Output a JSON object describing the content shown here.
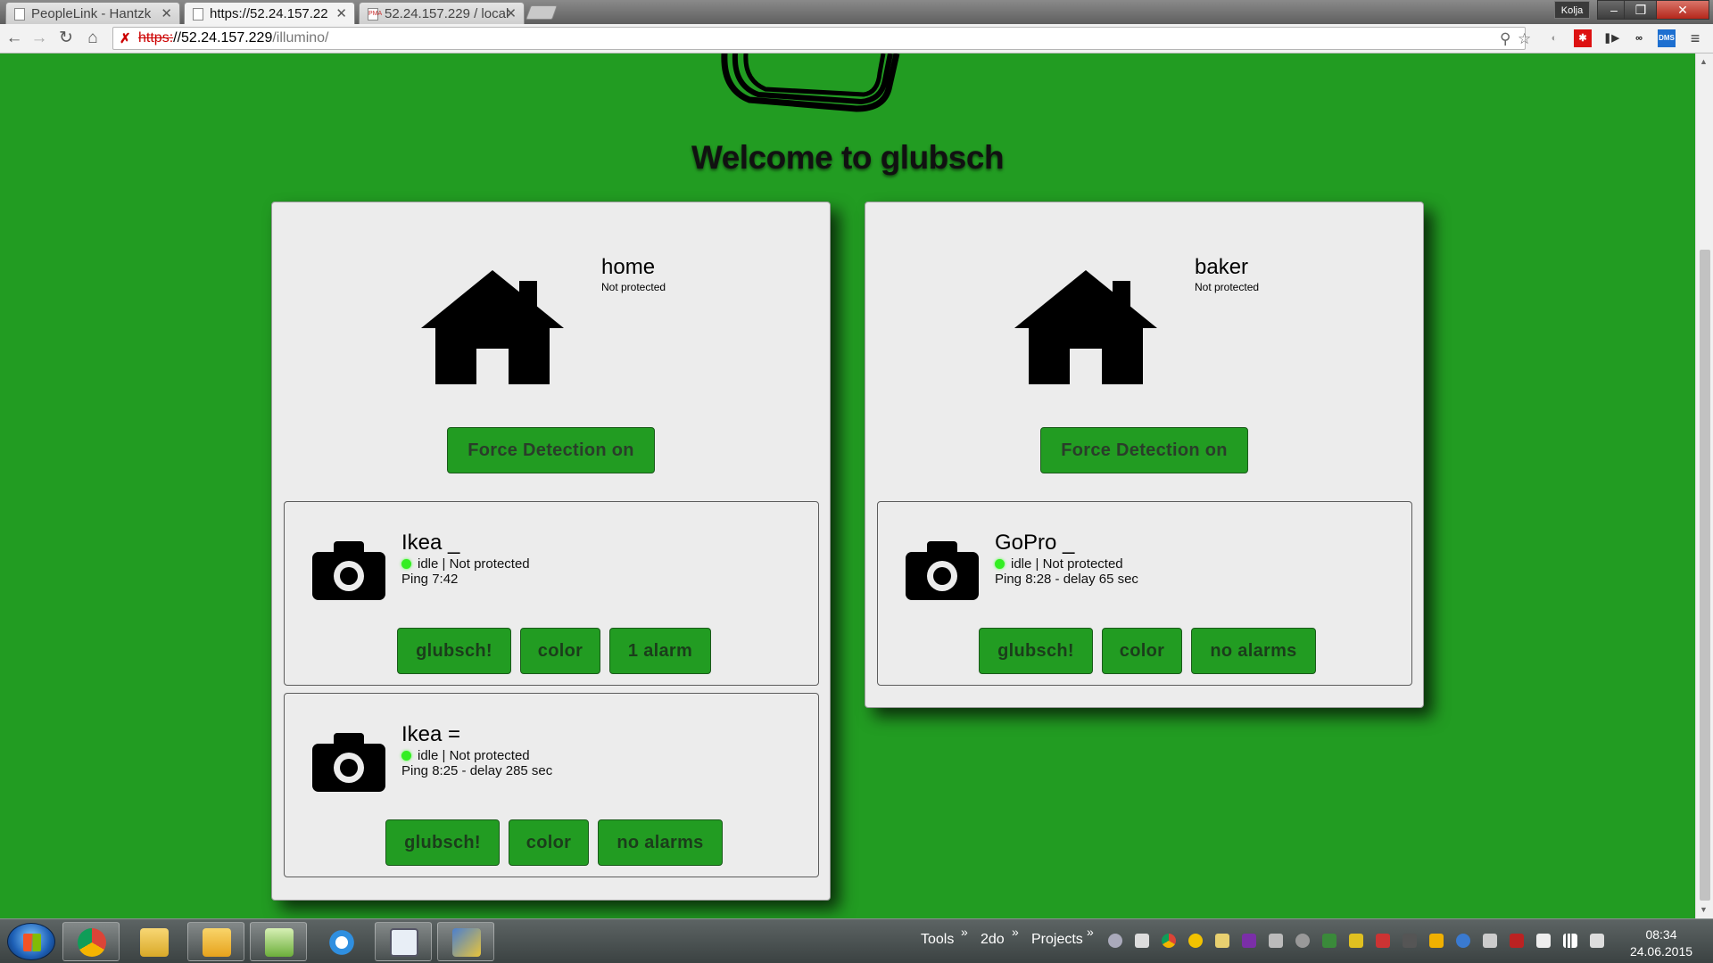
{
  "browser": {
    "tabs": [
      {
        "title": "PeopleLink - Hantzk",
        "favicon": "page-icon"
      },
      {
        "title": "https://52.24.157.22",
        "favicon": "page-icon"
      },
      {
        "title": "52.24.157.229 / local",
        "favicon": "PMA"
      }
    ],
    "user_badge": "Kolja",
    "url_scheme": "https:",
    "url_host": "//52.24.157.229",
    "url_path": "/illumino/",
    "extensions": [
      "zoom-icon",
      "star-icon",
      "shield-icon",
      "red-star-icon",
      "pause-icon",
      "glasses-icon",
      "DMS",
      "menu-icon"
    ]
  },
  "page": {
    "welcome": "Welcome to glubsch",
    "locations": [
      {
        "name": "home",
        "status": "Not protected",
        "force_label": "Force Detection on",
        "cameras": [
          {
            "name": "Ikea _",
            "state": "idle | Not protected",
            "ping": "Ping 7:42",
            "buttons": [
              "glubsch!",
              "color",
              "1 alarm"
            ]
          },
          {
            "name": "Ikea =",
            "state": "idle | Not protected",
            "ping": "Ping 8:25 - delay 285 sec",
            "buttons": [
              "glubsch!",
              "color",
              "no alarms"
            ]
          }
        ]
      },
      {
        "name": "baker",
        "status": "Not protected",
        "force_label": "Force Detection on",
        "cameras": [
          {
            "name": "GoPro _",
            "state": "idle | Not protected",
            "ping": "Ping 8:28 - delay 65 sec",
            "buttons": [
              "glubsch!",
              "color",
              "no alarms"
            ]
          }
        ]
      }
    ],
    "colors": {
      "background": "#229c22",
      "button": "#229c22",
      "card": "#ececec",
      "status_dot": "#33ee22"
    }
  },
  "taskbar": {
    "toolbars": [
      "Tools",
      "2do",
      "Projects"
    ],
    "time": "08:34",
    "date": "24.06.2015"
  }
}
